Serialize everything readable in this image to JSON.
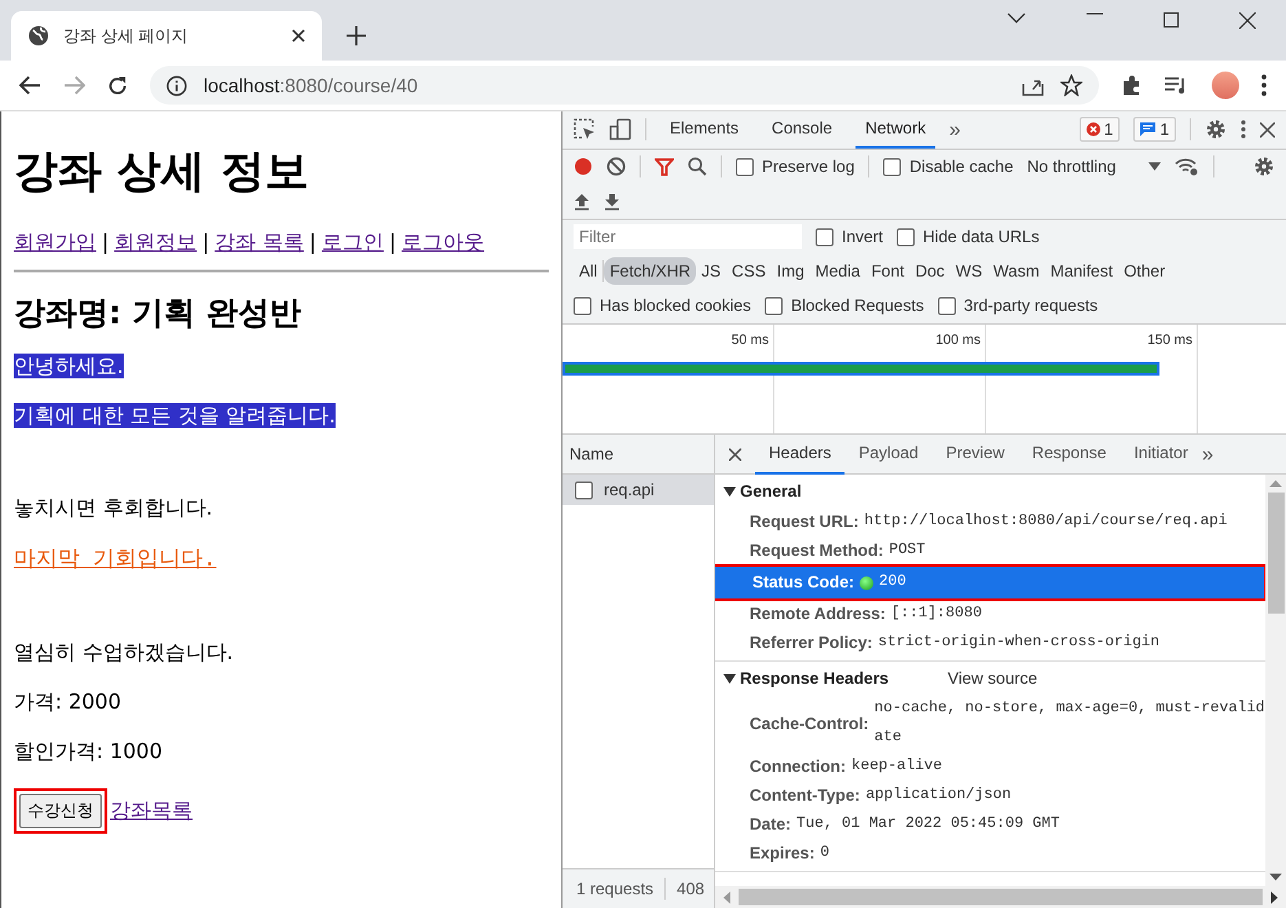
{
  "browser": {
    "tab_title": "강좌 상세 페이지",
    "url_host": "localhost",
    "url_rest": ":8080/course/40"
  },
  "page": {
    "title": "강좌 상세 정보",
    "nav": [
      "회원가입",
      "회원정보",
      "강좌 목록",
      "로그인",
      "로그아웃"
    ],
    "nav_separator": "|",
    "course_heading": "강좌명: 기획 완성반",
    "paragraph_groups": [
      [
        {
          "text": "안녕하세요.",
          "kind": "highlight"
        },
        {
          "text": "기획에 대한 모든 것을 알려줍니다.",
          "kind": "highlight"
        }
      ],
      [
        {
          "text": "놓치시면 후회합니다.",
          "kind": "plain"
        },
        {
          "text": "마지막 기회입니다.",
          "kind": "emphasis"
        }
      ],
      [
        {
          "text": "열심히 수업하겠습니다.",
          "kind": "plain"
        }
      ]
    ],
    "price": "가격: 2000",
    "discount_price": "할인가격: 1000",
    "enroll_button": {
      "label": "수강신청",
      "annotated": true
    },
    "list_link": "강좌목록"
  },
  "devtools": {
    "tabs": [
      {
        "label": "Elements",
        "selected": false
      },
      {
        "label": "Console",
        "selected": false
      },
      {
        "label": "Network",
        "selected": true
      }
    ],
    "more_tabs": "»",
    "error_count": "1",
    "message_count": "1",
    "toolbar": {
      "preserve_log": {
        "label": "Preserve log",
        "checked": false
      },
      "disable_cache": {
        "label": "Disable cache",
        "checked": false
      },
      "throttling": "No throttling"
    },
    "filter": {
      "placeholder": "Filter",
      "invert": {
        "label": "Invert",
        "checked": false
      },
      "hide_data_urls": {
        "label": "Hide data URLs",
        "checked": false
      }
    },
    "types": [
      {
        "label": "All",
        "selected": false
      },
      {
        "label": "Fetch/XHR",
        "selected": true
      },
      {
        "label": "JS",
        "selected": false
      },
      {
        "label": "CSS",
        "selected": false
      },
      {
        "label": "Img",
        "selected": false
      },
      {
        "label": "Media",
        "selected": false
      },
      {
        "label": "Font",
        "selected": false
      },
      {
        "label": "Doc",
        "selected": false
      },
      {
        "label": "WS",
        "selected": false
      },
      {
        "label": "Wasm",
        "selected": false
      },
      {
        "label": "Manifest",
        "selected": false
      },
      {
        "label": "Other",
        "selected": false
      }
    ],
    "extra_filters": [
      {
        "label": "Has blocked cookies",
        "checked": false
      },
      {
        "label": "Blocked Requests",
        "checked": false
      },
      {
        "label": "3rd-party requests",
        "checked": false
      }
    ],
    "timeline_ticks": [
      "50 ms",
      "100 ms",
      "150 ms"
    ],
    "requests": {
      "column": "Name",
      "rows": [
        {
          "name": "req.api",
          "selected": true
        }
      ],
      "summary": "1 requests",
      "size": "408"
    },
    "detail_tabs": [
      {
        "label": "Headers",
        "selected": true
      },
      {
        "label": "Payload",
        "selected": false
      },
      {
        "label": "Preview",
        "selected": false
      },
      {
        "label": "Response",
        "selected": false
      },
      {
        "label": "Initiator",
        "selected": false
      }
    ],
    "sections": [
      {
        "title": "General",
        "expanded": true,
        "rows": [
          {
            "key": "Request URL:",
            "value": "http://localhost:8080/api/course/req.api",
            "status_dot": false,
            "selected": false,
            "annotated": false
          },
          {
            "key": "Request Method:",
            "value": "POST",
            "status_dot": false,
            "selected": false,
            "annotated": false
          },
          {
            "key": "Status Code:",
            "value": "200",
            "status_dot": true,
            "selected": true,
            "annotated": true
          },
          {
            "key": "Remote Address:",
            "value": "[::1]:8080",
            "status_dot": false,
            "selected": false,
            "annotated": false
          },
          {
            "key": "Referrer Policy:",
            "value": "strict-origin-when-cross-origin",
            "status_dot": false,
            "selected": false,
            "annotated": false
          }
        ]
      },
      {
        "title": "Response Headers",
        "expanded": true,
        "link": "View source",
        "rows": [
          {
            "key": "Cache-Control:",
            "value": "no-cache, no-store, max-age=0, must-revalidate",
            "status_dot": false,
            "selected": false,
            "annotated": false
          },
          {
            "key": "Connection:",
            "value": "keep-alive",
            "status_dot": false,
            "selected": false,
            "annotated": false
          },
          {
            "key": "Content-Type:",
            "value": "application/json",
            "status_dot": false,
            "selected": false,
            "annotated": false
          },
          {
            "key": "Date:",
            "value": "Tue, 01 Mar 2022 05:45:09 GMT",
            "status_dot": false,
            "selected": false,
            "annotated": false
          },
          {
            "key": "Expires:",
            "value": "0",
            "status_dot": false,
            "selected": false,
            "annotated": false
          }
        ]
      }
    ]
  }
}
